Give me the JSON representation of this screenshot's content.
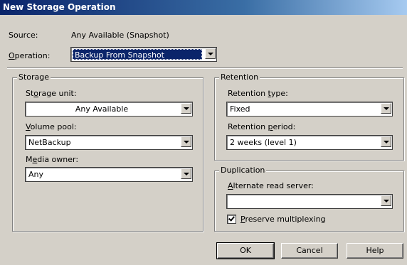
{
  "window": {
    "title": "New Storage Operation"
  },
  "source": {
    "label": "Source:",
    "value": "Any Available (Snapshot)"
  },
  "operation": {
    "label_accel": "O",
    "label_rest": "peration:",
    "value": "Backup From Snapshot"
  },
  "storage": {
    "group_title": "Storage",
    "unit_label_pre": "St",
    "unit_label_accel": "o",
    "unit_label_post": "rage unit:",
    "unit_value": "Any Available",
    "pool_label_accel": "V",
    "pool_label_rest": "olume pool:",
    "pool_value": "NetBackup",
    "owner_label_pre": "M",
    "owner_label_accel": "e",
    "owner_label_post": "dia owner:",
    "owner_value": "Any"
  },
  "retention": {
    "group_title": "Retention",
    "type_label_pre": "Retention ",
    "type_label_accel": "t",
    "type_label_post": "ype:",
    "type_value": "Fixed",
    "period_label_pre": "Retention ",
    "period_label_accel": "p",
    "period_label_post": "eriod:",
    "period_value": "2 weeks (level 1)"
  },
  "duplication": {
    "group_title": "Duplication",
    "server_label_accel": "A",
    "server_label_rest": "lternate read server:",
    "server_value": "",
    "multiplex_accel": "P",
    "multiplex_rest": "reserve multiplexing",
    "multiplex_checked": true
  },
  "buttons": {
    "ok": "OK",
    "cancel": "Cancel",
    "help": "Help"
  }
}
